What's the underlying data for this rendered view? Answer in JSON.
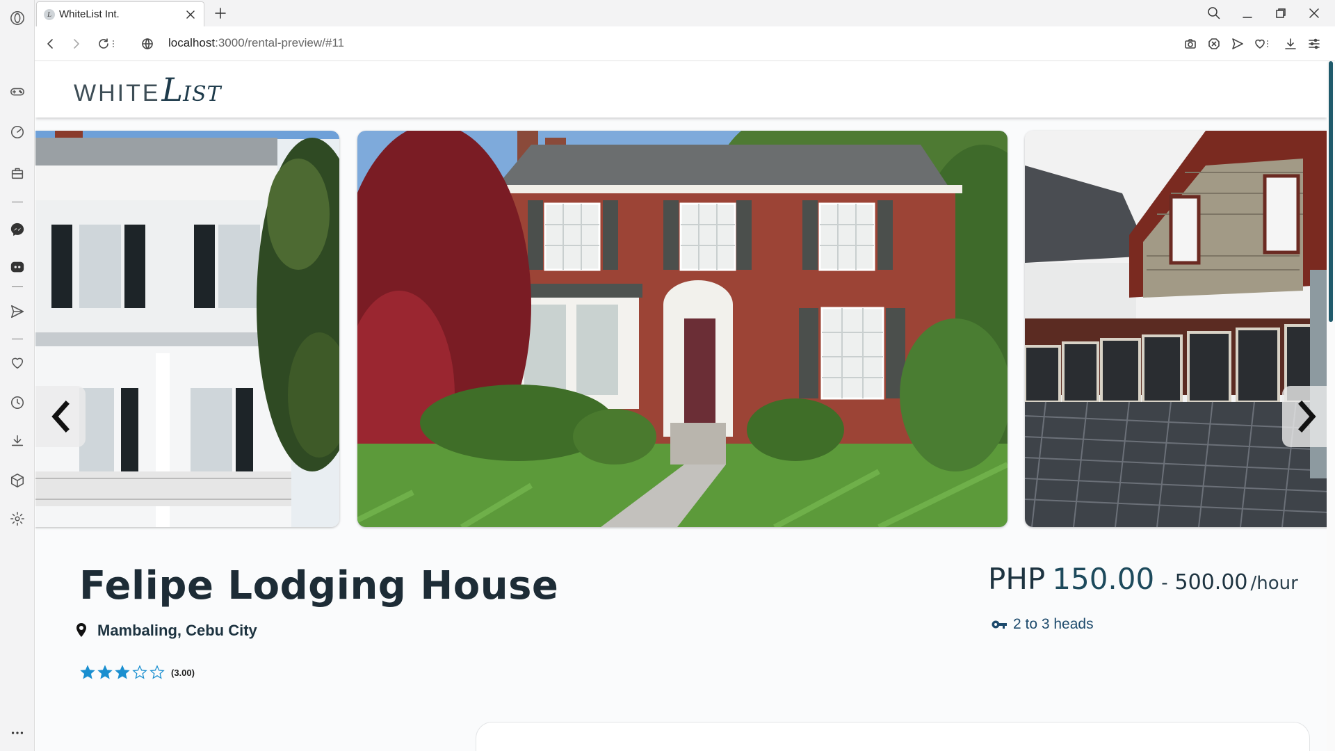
{
  "browser": {
    "tab_title": "WhiteList Int.",
    "tab_favicon": "L",
    "url_host": "localhost",
    "url_rest": ":3000/rental-preview/#11"
  },
  "site": {
    "logo_white": "WHITE",
    "logo_l": "L",
    "logo_ist": "IST"
  },
  "listing": {
    "title": "Felipe Lodging House",
    "location": "Mambaling, Cebu City",
    "rating_value": 3,
    "rating_max": 5,
    "rating_text": "(3.00)",
    "price_currency": "PHP",
    "price_low": "150.00",
    "price_dash": "-",
    "price_high": "500.00",
    "price_unit": "/hour",
    "heads": "2 to 3 heads"
  },
  "colors": {
    "accent": "#1d4a5c",
    "star": "#1a8fd0",
    "scroll_thumb": "#1f5a6b"
  },
  "icons": {
    "rail": [
      "opera-logo-icon",
      "gamepad-icon",
      "speed-dial-icon",
      "bag-icon",
      "messenger-icon",
      "discord-icon",
      "send-icon",
      "heart-icon",
      "clock-icon",
      "download-icon",
      "cube-icon",
      "settings-icon",
      "more-icon"
    ]
  }
}
